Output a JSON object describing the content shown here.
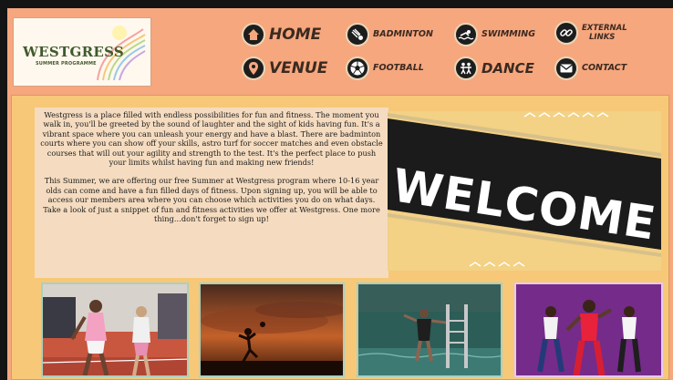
{
  "logo": {
    "title": "WESTGRESS",
    "subtitle": "SUMMER PROGRAMME"
  },
  "nav": {
    "home": "HOME",
    "venue": "VENUE",
    "badminton": "BADMINTON",
    "football": "FOOTBALL",
    "swimming": "SWIMMING",
    "dance": "DANCE",
    "external_links_line1": "EXTERNAL",
    "external_links_line2": "LINKS",
    "contact": "CONTACT"
  },
  "intro": {
    "paragraph1": "Westgress is a place filled with endless possibilities for fun and fitness. The moment you walk in, you'll be greeted by the sound of laughter and the sight of kids having fun. It's a vibrant space where you can unleash your energy and have a blast. There are badminton courts where you can show off your skills, astro turf for soccer matches and even obstacle courses that will out your agility and strength to the test. It's the perfect place to push your limits whilst having fun and making new friends!",
    "paragraph2": "This Summer, we are offering our free Summer at Westgress program where 10-16 year olds can come and have a fun filled days of fitness.  Upon signing up, you will be able to access our members area where you can choose which activities you do on what days.  Take a look of just a snippet of fun and fitness activities we offer at Westgress. One more thing…don't forget to sign up!"
  },
  "banner": {
    "text": "WELCOME"
  },
  "colors": {
    "page_background": "#f6a77e",
    "content_background": "#f7c878",
    "text_panel_background": "#f5dcc0",
    "banner_black": "#1b1b1b",
    "banner_yellow": "#f3d185"
  },
  "icons": {
    "home": "home-icon",
    "venue": "location-pin-icon",
    "badminton": "shuttlecock-icon",
    "football": "football-icon",
    "swimming": "swimmer-icon",
    "dance": "dancers-icon",
    "external_links": "link-chain-icon",
    "contact": "envelope-icon"
  }
}
